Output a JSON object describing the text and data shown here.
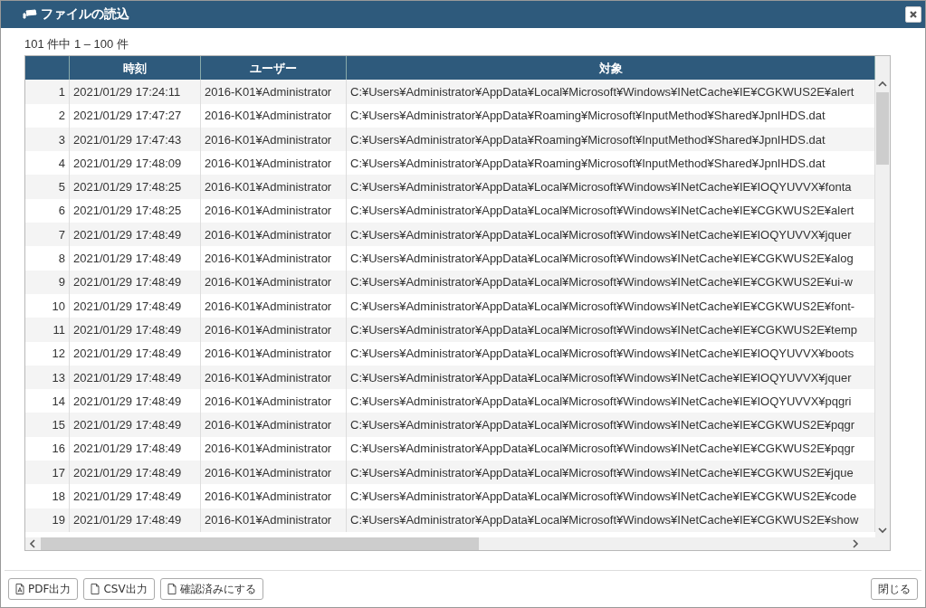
{
  "window": {
    "title": "ファイルの読込"
  },
  "record_count": "101 件中 1 – 100 件",
  "table": {
    "columns": [
      "",
      "時刻",
      "ユーザー",
      "対象"
    ],
    "rows": [
      [
        "1",
        "2021/01/29 17:24:11",
        "2016-K01¥Administrator",
        "C:¥Users¥Administrator¥AppData¥Local¥Microsoft¥Windows¥INetCache¥IE¥CGKWUS2E¥alert"
      ],
      [
        "2",
        "2021/01/29 17:47:27",
        "2016-K01¥Administrator",
        "C:¥Users¥Administrator¥AppData¥Roaming¥Microsoft¥InputMethod¥Shared¥JpnIHDS.dat"
      ],
      [
        "3",
        "2021/01/29 17:47:43",
        "2016-K01¥Administrator",
        "C:¥Users¥Administrator¥AppData¥Roaming¥Microsoft¥InputMethod¥Shared¥JpnIHDS.dat"
      ],
      [
        "4",
        "2021/01/29 17:48:09",
        "2016-K01¥Administrator",
        "C:¥Users¥Administrator¥AppData¥Roaming¥Microsoft¥InputMethod¥Shared¥JpnIHDS.dat"
      ],
      [
        "5",
        "2021/01/29 17:48:25",
        "2016-K01¥Administrator",
        "C:¥Users¥Administrator¥AppData¥Local¥Microsoft¥Windows¥INetCache¥IE¥IOQYUVVX¥fonta"
      ],
      [
        "6",
        "2021/01/29 17:48:25",
        "2016-K01¥Administrator",
        "C:¥Users¥Administrator¥AppData¥Local¥Microsoft¥Windows¥INetCache¥IE¥CGKWUS2E¥alert"
      ],
      [
        "7",
        "2021/01/29 17:48:49",
        "2016-K01¥Administrator",
        "C:¥Users¥Administrator¥AppData¥Local¥Microsoft¥Windows¥INetCache¥IE¥IOQYUVVX¥jquer"
      ],
      [
        "8",
        "2021/01/29 17:48:49",
        "2016-K01¥Administrator",
        "C:¥Users¥Administrator¥AppData¥Local¥Microsoft¥Windows¥INetCache¥IE¥CGKWUS2E¥alog"
      ],
      [
        "9",
        "2021/01/29 17:48:49",
        "2016-K01¥Administrator",
        "C:¥Users¥Administrator¥AppData¥Local¥Microsoft¥Windows¥INetCache¥IE¥CGKWUS2E¥ui-w"
      ],
      [
        "10",
        "2021/01/29 17:48:49",
        "2016-K01¥Administrator",
        "C:¥Users¥Administrator¥AppData¥Local¥Microsoft¥Windows¥INetCache¥IE¥CGKWUS2E¥font-"
      ],
      [
        "11",
        "2021/01/29 17:48:49",
        "2016-K01¥Administrator",
        "C:¥Users¥Administrator¥AppData¥Local¥Microsoft¥Windows¥INetCache¥IE¥CGKWUS2E¥temp"
      ],
      [
        "12",
        "2021/01/29 17:48:49",
        "2016-K01¥Administrator",
        "C:¥Users¥Administrator¥AppData¥Local¥Microsoft¥Windows¥INetCache¥IE¥IOQYUVVX¥boots"
      ],
      [
        "13",
        "2021/01/29 17:48:49",
        "2016-K01¥Administrator",
        "C:¥Users¥Administrator¥AppData¥Local¥Microsoft¥Windows¥INetCache¥IE¥IOQYUVVX¥jquer"
      ],
      [
        "14",
        "2021/01/29 17:48:49",
        "2016-K01¥Administrator",
        "C:¥Users¥Administrator¥AppData¥Local¥Microsoft¥Windows¥INetCache¥IE¥IOQYUVVX¥pqgri"
      ],
      [
        "15",
        "2021/01/29 17:48:49",
        "2016-K01¥Administrator",
        "C:¥Users¥Administrator¥AppData¥Local¥Microsoft¥Windows¥INetCache¥IE¥CGKWUS2E¥pqgr"
      ],
      [
        "16",
        "2021/01/29 17:48:49",
        "2016-K01¥Administrator",
        "C:¥Users¥Administrator¥AppData¥Local¥Microsoft¥Windows¥INetCache¥IE¥CGKWUS2E¥pqgr"
      ],
      [
        "17",
        "2021/01/29 17:48:49",
        "2016-K01¥Administrator",
        "C:¥Users¥Administrator¥AppData¥Local¥Microsoft¥Windows¥INetCache¥IE¥CGKWUS2E¥jque"
      ],
      [
        "18",
        "2021/01/29 17:48:49",
        "2016-K01¥Administrator",
        "C:¥Users¥Administrator¥AppData¥Local¥Microsoft¥Windows¥INetCache¥IE¥CGKWUS2E¥code"
      ],
      [
        "19",
        "2021/01/29 17:48:49",
        "2016-K01¥Administrator",
        "C:¥Users¥Administrator¥AppData¥Local¥Microsoft¥Windows¥INetCache¥IE¥CGKWUS2E¥show"
      ]
    ]
  },
  "footer_buttons": [
    {
      "label": "PDF出力",
      "kind": "pdf"
    },
    {
      "label": "CSV出力",
      "kind": "file"
    },
    {
      "label": "確認済みにする",
      "kind": "file"
    }
  ],
  "close_button": {
    "label": "閉じる"
  }
}
